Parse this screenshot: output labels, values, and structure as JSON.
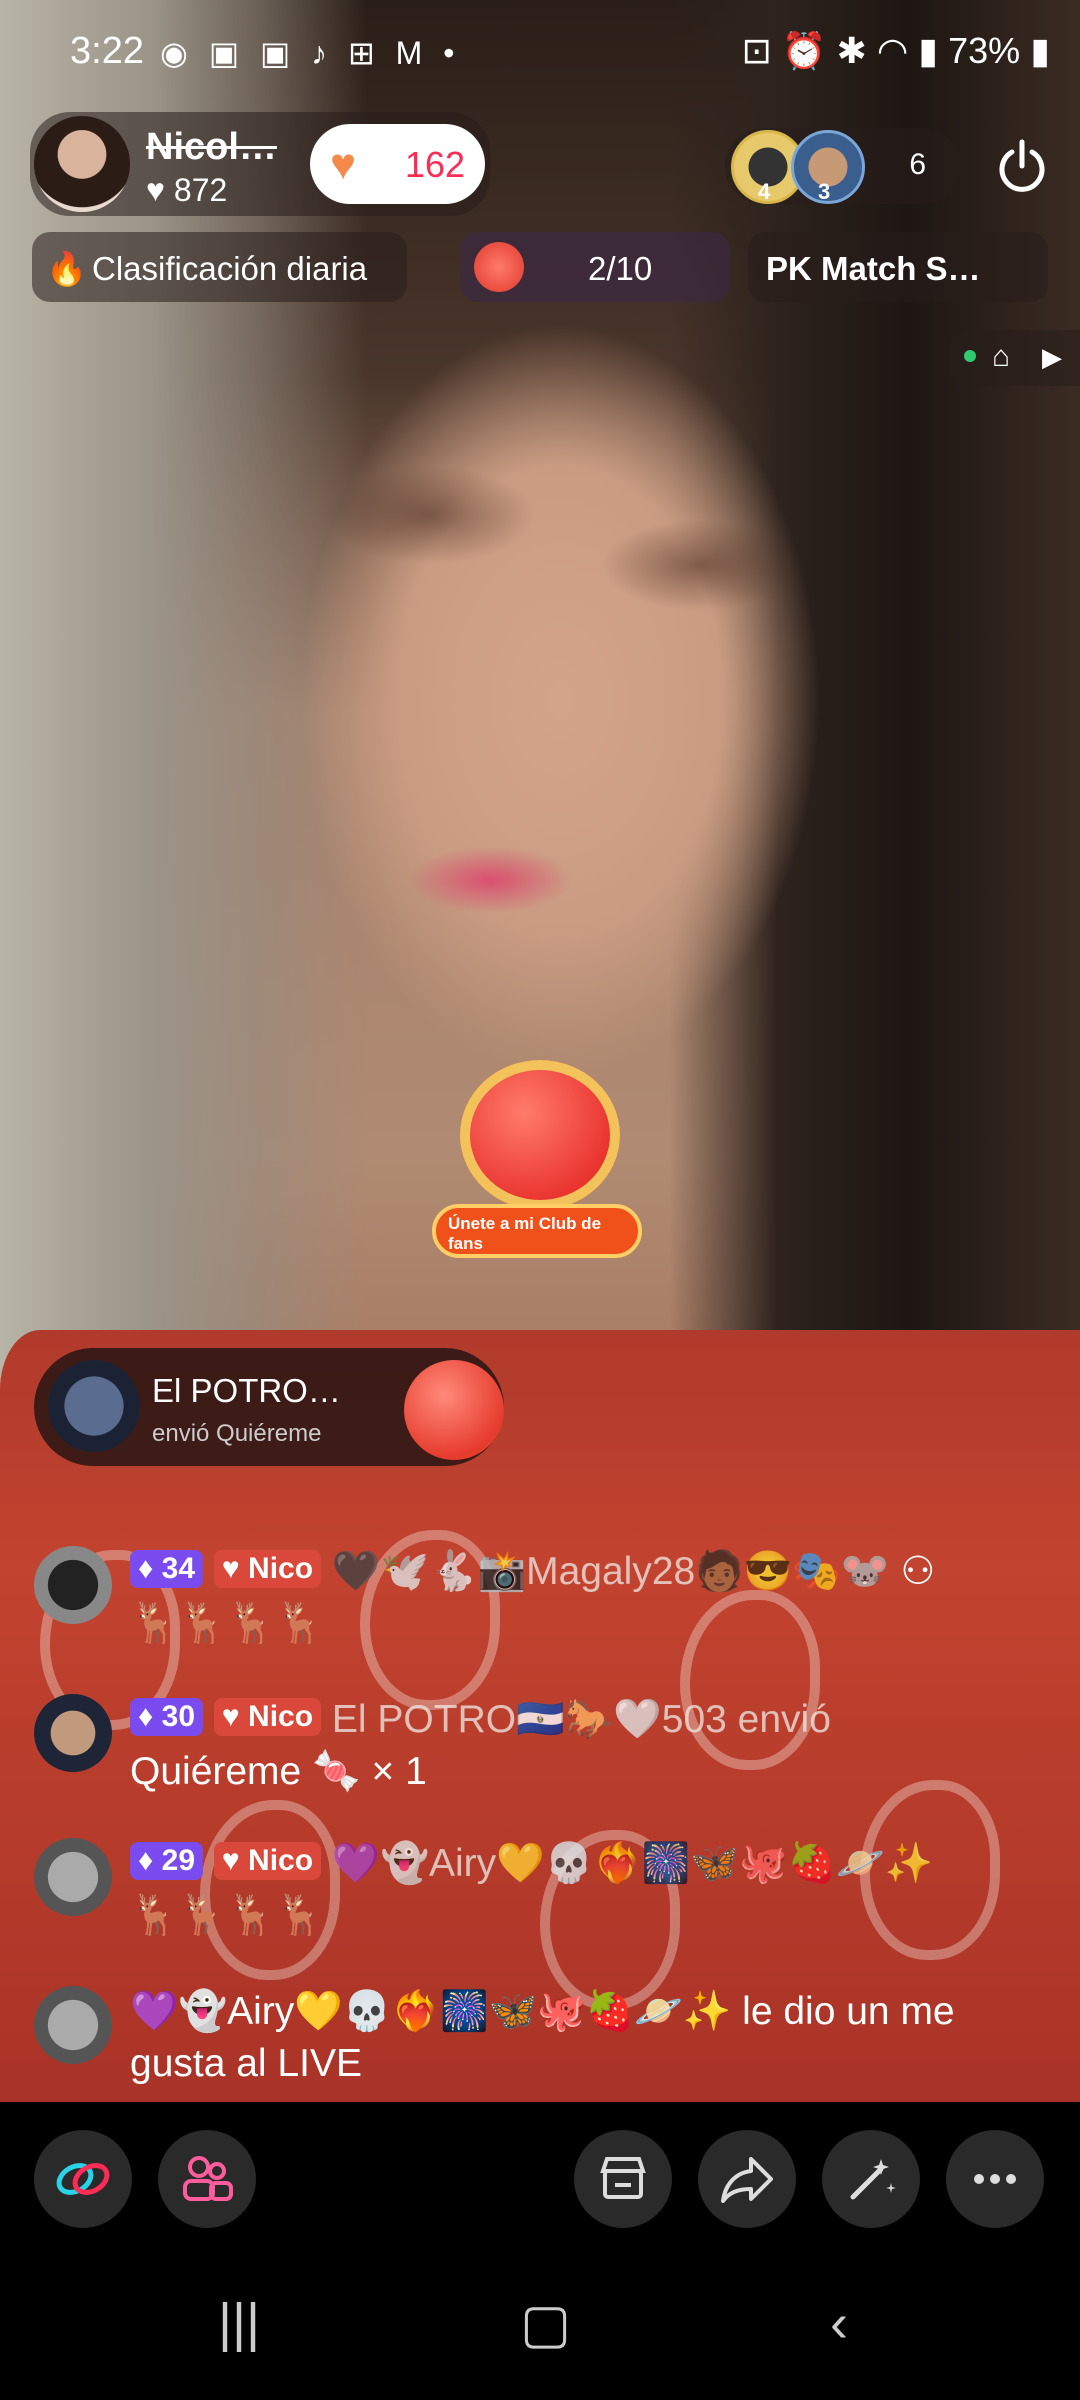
{
  "status_bar": {
    "time": "3:22",
    "notif_icons": [
      "whatsapp-icon",
      "s-icon",
      "s-icon",
      "tiktok-icon",
      "vpn-icon",
      "gmail-icon",
      "dot-icon"
    ],
    "battery": "73%"
  },
  "host": {
    "name": "Nicol…",
    "likes": "872"
  },
  "follow": {
    "count": "162"
  },
  "viewers": {
    "avatars": [
      {
        "rank": "4"
      },
      {
        "rank": "3"
      }
    ],
    "count": "6"
  },
  "chips": {
    "ranking": "Clasificación diaria",
    "progress": "2/10",
    "pk": "PK Match S…"
  },
  "fan_club": {
    "label": "Únete a mi Club de fans"
  },
  "gift_banner": {
    "user": "El POTRO…",
    "action": "envió Quiéreme"
  },
  "comments": [
    {
      "level": "34",
      "fan": "Nico",
      "text": "🖤🕊️🐇📸Magaly28🧑🏾😎🎭🐭",
      "line2": "🦌🦌🦌🦌"
    },
    {
      "level": "30",
      "fan": "Nico",
      "text": "El POTRO🇸🇻🐎🤍503 envió",
      "line2": "Quiéreme 🍬 × 1"
    },
    {
      "level": "29",
      "fan": "Nico",
      "text": "💜👻Airy💛💀❤️‍🔥🎆🦋🐙🍓🪐✨",
      "line2": "🦌🦌🦌🦌"
    },
    {
      "text": "💜👻Airy💛💀❤️‍🔥🎆🦋🐙🍓🪐✨ le dio un me",
      "line2": "gusta al LIVE"
    }
  ],
  "colors": {
    "accent": "#fe2c55",
    "level_badge": "#7a4cf0",
    "fan_badge": "#d9483a"
  },
  "toolbar": {
    "buttons": [
      "multi-guest-icon",
      "guests-icon",
      "shop-icon",
      "share-icon",
      "magic-wand-icon",
      "more-icon"
    ]
  }
}
